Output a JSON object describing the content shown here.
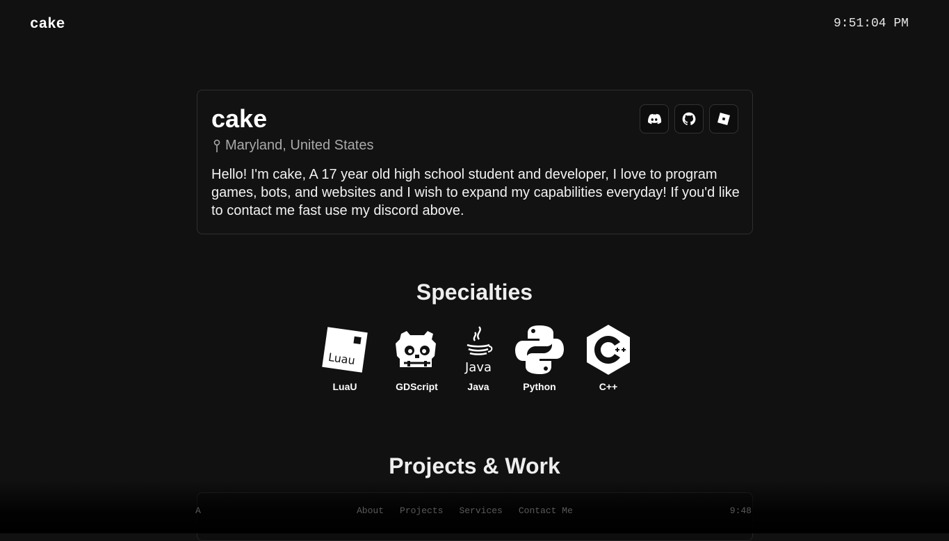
{
  "header": {
    "brand": "cake",
    "clock": "9:51:04 PM"
  },
  "profile": {
    "name": "cake",
    "location": "Maryland, United States",
    "bio": "Hello! I'm cake, A 17 year old high school student and developer, I love to program games, bots, and websites and I wish to expand my capabilities everyday! If you'd like to contact me fast use my discord above.",
    "socials": [
      {
        "icon": "discord-icon"
      },
      {
        "icon": "github-icon"
      },
      {
        "icon": "roblox-icon"
      }
    ]
  },
  "specialties": {
    "heading": "Specialties",
    "items": [
      {
        "label": "LuaU",
        "icon": "luau-icon",
        "logo_text": "Luau"
      },
      {
        "label": "GDScript",
        "icon": "godot-icon"
      },
      {
        "label": "Java",
        "icon": "java-icon",
        "logo_text": "Java"
      },
      {
        "label": "Python",
        "icon": "python-icon"
      },
      {
        "label": "C++",
        "icon": "cpp-icon"
      }
    ]
  },
  "projects": {
    "heading": "Projects & Work"
  },
  "nav": {
    "left": "A",
    "links": [
      "About",
      "Projects",
      "Services",
      "Contact Me"
    ],
    "time": "9:48"
  }
}
